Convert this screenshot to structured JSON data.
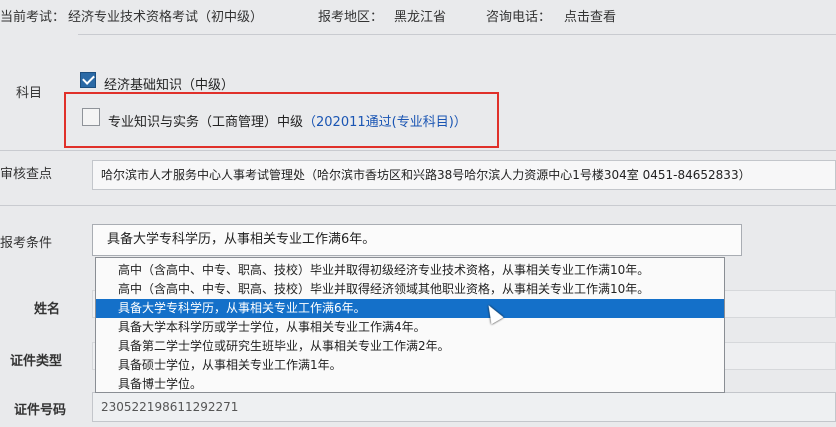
{
  "header": {
    "exam_label": "当前考试：",
    "exam_value": "经济专业技术资格考试（初中级）",
    "region_label": "报考地区：",
    "region_value": "黑龙江省",
    "phone_label": "咨询电话：",
    "phone_link": "点击查看"
  },
  "subjects": {
    "label": "科目",
    "items": [
      {
        "text": "经济基础知识（中级）",
        "checked": true
      },
      {
        "text": "专业知识与实务（工商管理）中级",
        "note": "（202011通过(专业科目)）",
        "checked": false
      }
    ]
  },
  "review_point": {
    "label": "审核查点",
    "value": "哈尔滨市人才服务中心人事考试管理处（哈尔滨市香坊区和兴路38号哈尔滨人力资源中心1号楼304室 0451-84652833）"
  },
  "condition": {
    "label": "报考条件",
    "selected": "具备大学专科学历，从事相关专业工作满6年。",
    "options": [
      "高中（含高中、中专、职高、技校）毕业并取得初级经济专业技术资格，从事相关专业工作满10年。",
      "高中（含高中、中专、职高、技校）毕业并取得经济领域其他职业资格，从事相关专业工作满10年。",
      "具备大学专科学历，从事相关专业工作满6年。",
      "具备大学本科学历或学士学位，从事相关专业工作满4年。",
      "具备第二学士学位或研究生班毕业，从事相关专业工作满2年。",
      "具备硕士学位，从事相关专业工作满1年。",
      "具备博士学位。"
    ],
    "highlighted_index": 2
  },
  "name": {
    "label": "姓名"
  },
  "id_type": {
    "label": "证件类型"
  },
  "id_number": {
    "label": "证件号码",
    "value": "230522198611292271"
  },
  "colors": {
    "accent": "#1470c9",
    "annotation": "#e0302a",
    "link": "#1a55b3"
  }
}
